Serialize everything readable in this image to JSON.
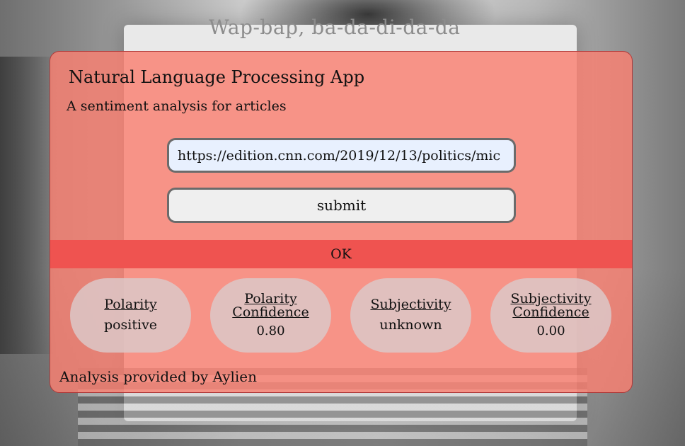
{
  "background": {
    "headline": "Wap-bap, ba-da-di-da-da"
  },
  "app": {
    "title": "Natural Language Processing App",
    "subtitle": "A sentiment analysis for articles"
  },
  "form": {
    "url_value": "https://edition.cnn.com/2019/12/13/politics/mic",
    "submit_label": "submit"
  },
  "status": {
    "text": "OK"
  },
  "metrics": {
    "polarity": {
      "label": "Polarity",
      "value": "positive"
    },
    "polarity_confidence": {
      "label": "Polarity Confidence",
      "value": "0.80"
    },
    "subjectivity": {
      "label": "Subjectivity",
      "value": "unknown"
    },
    "subjectivity_confidence": {
      "label": "Subjectivity Confidence",
      "value": "0.00"
    }
  },
  "footer": {
    "text": "Analysis provided by Aylien"
  },
  "colors": {
    "card": "#fa8072",
    "status_bar": "#ef5350",
    "input_bg": "#e8f0fe"
  }
}
